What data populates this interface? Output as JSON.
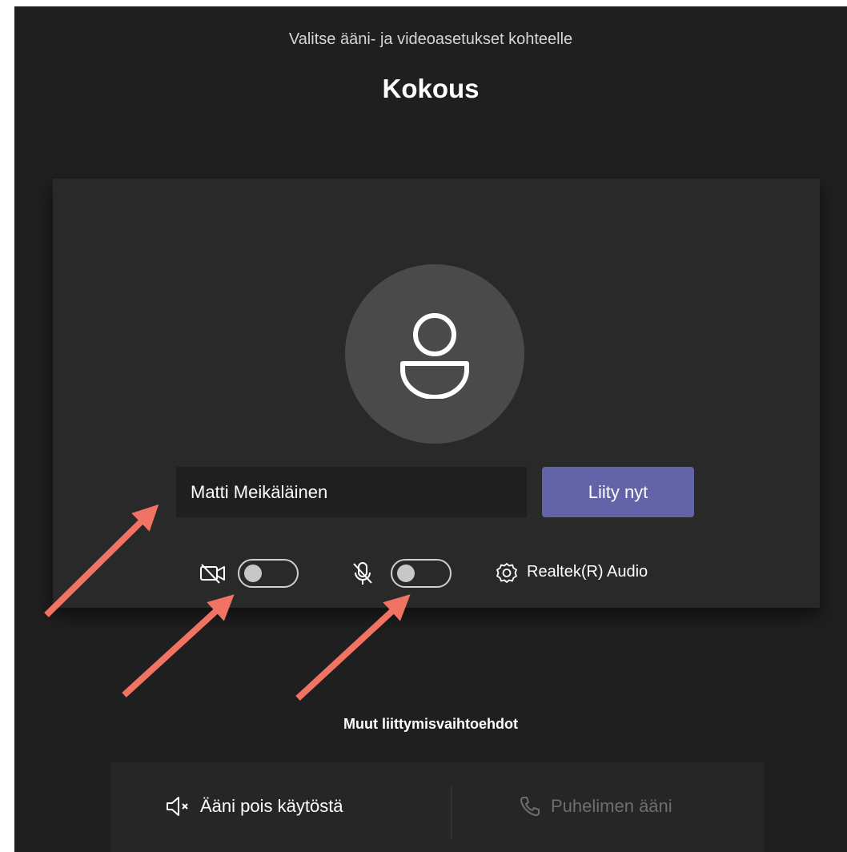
{
  "header": {
    "subtitle": "Valitse ääni- ja videoasetukset kohteelle",
    "title": "Kokous"
  },
  "prejoin": {
    "avatar_icon": "person-icon",
    "name_value": "Matti Meikäläinen",
    "join_label": "Liity nyt",
    "camera": {
      "icon": "camera-off-icon",
      "on": false
    },
    "microphone": {
      "icon": "mic-off-icon",
      "on": false
    },
    "device": {
      "icon": "gear-icon",
      "label": "Realtek(R) Audio"
    }
  },
  "other_options": {
    "heading": "Muut liittymisvaihtoehdot",
    "audio_off": {
      "icon": "speaker-muted-icon",
      "label": "Ääni pois käytöstä"
    },
    "phone_audio": {
      "icon": "phone-icon",
      "label": "Puhelimen ääni"
    }
  },
  "colors": {
    "background": "#1f1f1f",
    "card": "#292929",
    "accent": "#6264a7",
    "annotation_arrow": "#f07363"
  }
}
